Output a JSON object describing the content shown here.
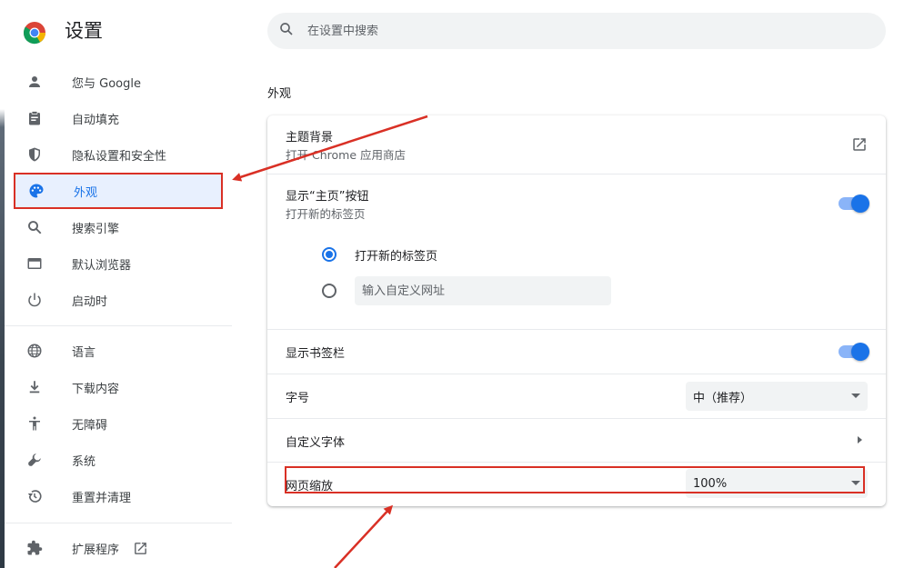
{
  "app": {
    "title": "设置"
  },
  "search": {
    "placeholder": "在设置中搜索"
  },
  "sidebar": {
    "items": [
      {
        "label": "您与 Google",
        "icon": "person-icon"
      },
      {
        "label": "自动填充",
        "icon": "clipboard-icon"
      },
      {
        "label": "隐私设置和安全性",
        "icon": "shield-icon"
      },
      {
        "label": "外观",
        "icon": "palette-icon",
        "active": true
      },
      {
        "label": "搜索引擎",
        "icon": "search-icon"
      },
      {
        "label": "默认浏览器",
        "icon": "browser-window-icon"
      },
      {
        "label": "启动时",
        "icon": "power-icon"
      },
      {
        "label": "语言",
        "icon": "globe-icon"
      },
      {
        "label": "下载内容",
        "icon": "download-icon"
      },
      {
        "label": "无障碍",
        "icon": "accessibility-icon"
      },
      {
        "label": "系统",
        "icon": "wrench-icon"
      },
      {
        "label": "重置并清理",
        "icon": "restore-icon"
      },
      {
        "label": "扩展程序",
        "icon": "puzzle-icon"
      }
    ]
  },
  "main": {
    "section_title": "外观",
    "theme": {
      "title": "主题背景",
      "subtitle": "打开 Chrome 应用商店"
    },
    "home_button": {
      "title": "显示“主页”按钮",
      "subtitle": "打开新的标签页",
      "enabled": true,
      "options": [
        {
          "label": "打开新的标签页",
          "selected": true
        },
        {
          "placeholder": "输入自定义网址",
          "selected": false
        }
      ]
    },
    "bookmarks_bar": {
      "title": "显示书签栏",
      "enabled": true
    },
    "font_size": {
      "title": "字号",
      "value": "中（推荐）"
    },
    "custom_fonts": {
      "title": "自定义字体"
    },
    "page_zoom": {
      "title": "网页缩放",
      "value": "100%"
    }
  },
  "colors": {
    "accent": "#1a73e8",
    "annotation": "#d93025"
  }
}
